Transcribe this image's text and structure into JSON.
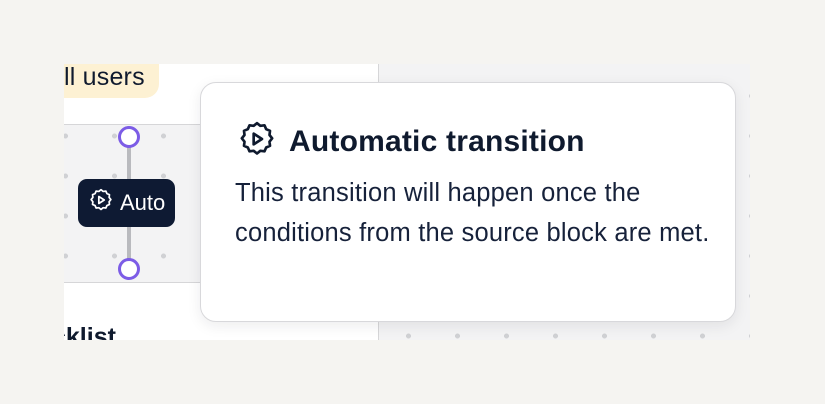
{
  "canvas": {
    "top_badge_text": "ll users",
    "bottom_card_text": "cklist",
    "auto_pill": {
      "label": "Auto",
      "icon": "gear-play-icon"
    }
  },
  "tooltip": {
    "icon": "gear-play-icon",
    "title": "Automatic transition",
    "body": "This transition will happen once the conditions from the source block are met."
  },
  "colors": {
    "accent": "#7c5ce6",
    "pill_bg": "#0e1a33",
    "badge_bg": "#fdf1d3",
    "text": "#0f1a2e"
  }
}
